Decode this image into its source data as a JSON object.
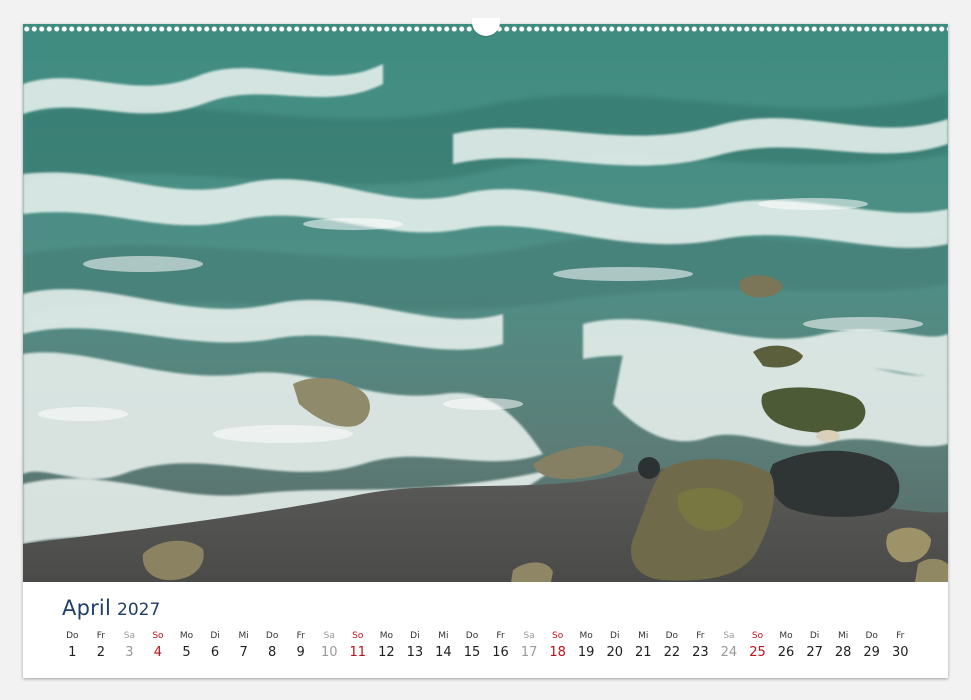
{
  "calendar": {
    "month": "April",
    "year": "2027",
    "days": [
      {
        "wd": "Do",
        "d": "1"
      },
      {
        "wd": "Fr",
        "d": "2"
      },
      {
        "wd": "Sa",
        "d": "3"
      },
      {
        "wd": "So",
        "d": "4"
      },
      {
        "wd": "Mo",
        "d": "5"
      },
      {
        "wd": "Di",
        "d": "6"
      },
      {
        "wd": "Mi",
        "d": "7"
      },
      {
        "wd": "Do",
        "d": "8"
      },
      {
        "wd": "Fr",
        "d": "9"
      },
      {
        "wd": "Sa",
        "d": "10"
      },
      {
        "wd": "So",
        "d": "11"
      },
      {
        "wd": "Mo",
        "d": "12"
      },
      {
        "wd": "Di",
        "d": "13"
      },
      {
        "wd": "Mi",
        "d": "14"
      },
      {
        "wd": "Do",
        "d": "15"
      },
      {
        "wd": "Fr",
        "d": "16"
      },
      {
        "wd": "Sa",
        "d": "17"
      },
      {
        "wd": "So",
        "d": "18"
      },
      {
        "wd": "Mo",
        "d": "19"
      },
      {
        "wd": "Di",
        "d": "20"
      },
      {
        "wd": "Mi",
        "d": "21"
      },
      {
        "wd": "Do",
        "d": "22"
      },
      {
        "wd": "Fr",
        "d": "23"
      },
      {
        "wd": "Sa",
        "d": "24"
      },
      {
        "wd": "So",
        "d": "25"
      },
      {
        "wd": "Mo",
        "d": "26"
      },
      {
        "wd": "Di",
        "d": "27"
      },
      {
        "wd": "Mi",
        "d": "28"
      },
      {
        "wd": "Do",
        "d": "29"
      },
      {
        "wd": "Fr",
        "d": "30"
      }
    ]
  },
  "colors": {
    "title": "#1f3e69",
    "sunday": "#c0121a",
    "saturday": "#9a9a9a",
    "weekday": "#1f1f1f"
  }
}
